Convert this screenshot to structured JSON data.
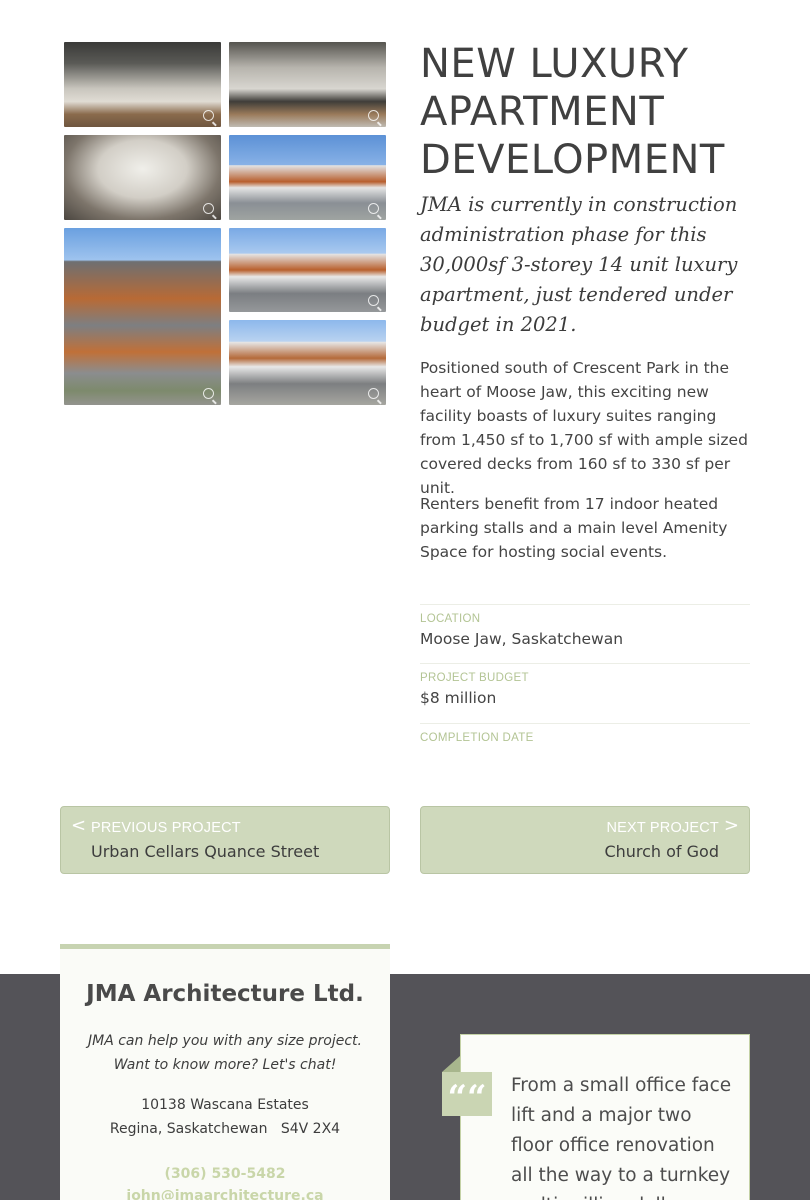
{
  "project": {
    "title": "NEW LUXURY APARTMENT DEVELOPMENT",
    "lead": "JMA is currently in construction administration phase for this 30,000sf 3-storey 14 unit luxury apartment, just tendered under budget in 2021.",
    "paragraphs": [
      "Positioned south of Crescent Park in the heart of Moose Jaw, this exciting new facility boasts of luxury suites ranging from 1,450 sf to 1,700 sf with ample sized covered decks from 160 sf to 330 sf per unit.",
      "Renters benefit from 17 indoor heated parking stalls and a main level Amenity Space for hosting social events."
    ]
  },
  "details": {
    "location_label": "LOCATION",
    "location_value": "Moose Jaw, Saskatchewan",
    "budget_label": "PROJECT BUDGET",
    "budget_value": "$8 million",
    "completion_label": "COMPLETION DATE",
    "completion_value": ""
  },
  "gallery": {
    "icon": "zoom-icon",
    "images": [
      "interior-living-kitchen",
      "interior-open-plan",
      "interior-panorama",
      "exterior-corner-view",
      "exterior-street-view",
      "exterior-front-view",
      "exterior-side-view"
    ]
  },
  "navigation": {
    "prev_label": "PREVIOUS PROJECT",
    "prev_name": "Urban Cellars Quance Street",
    "next_label": "NEXT PROJECT",
    "next_name": "Church of God",
    "prev_arrow": "<",
    "next_arrow": ">"
  },
  "contact": {
    "company": "JMA Architecture Ltd.",
    "tagline": "JMA can help you with any size project. Want to know more? Let's chat!",
    "address_line1": "10138 Wascana Estates",
    "address_line2": "Regina, Saskatchewan   S4V 2X4",
    "phone": "(306) 530-5482",
    "email": "john@jmaarchitecture.ca"
  },
  "testimonial": {
    "quote_mark": "““",
    "text": "From a small office face lift and a major two floor office renovation all the way to a turnkey multi-million dollar"
  },
  "colors": {
    "accent": "#c9d6a9",
    "nav_bg": "#cfd9bc",
    "footer_bg": "#545358",
    "text": "#444444"
  }
}
